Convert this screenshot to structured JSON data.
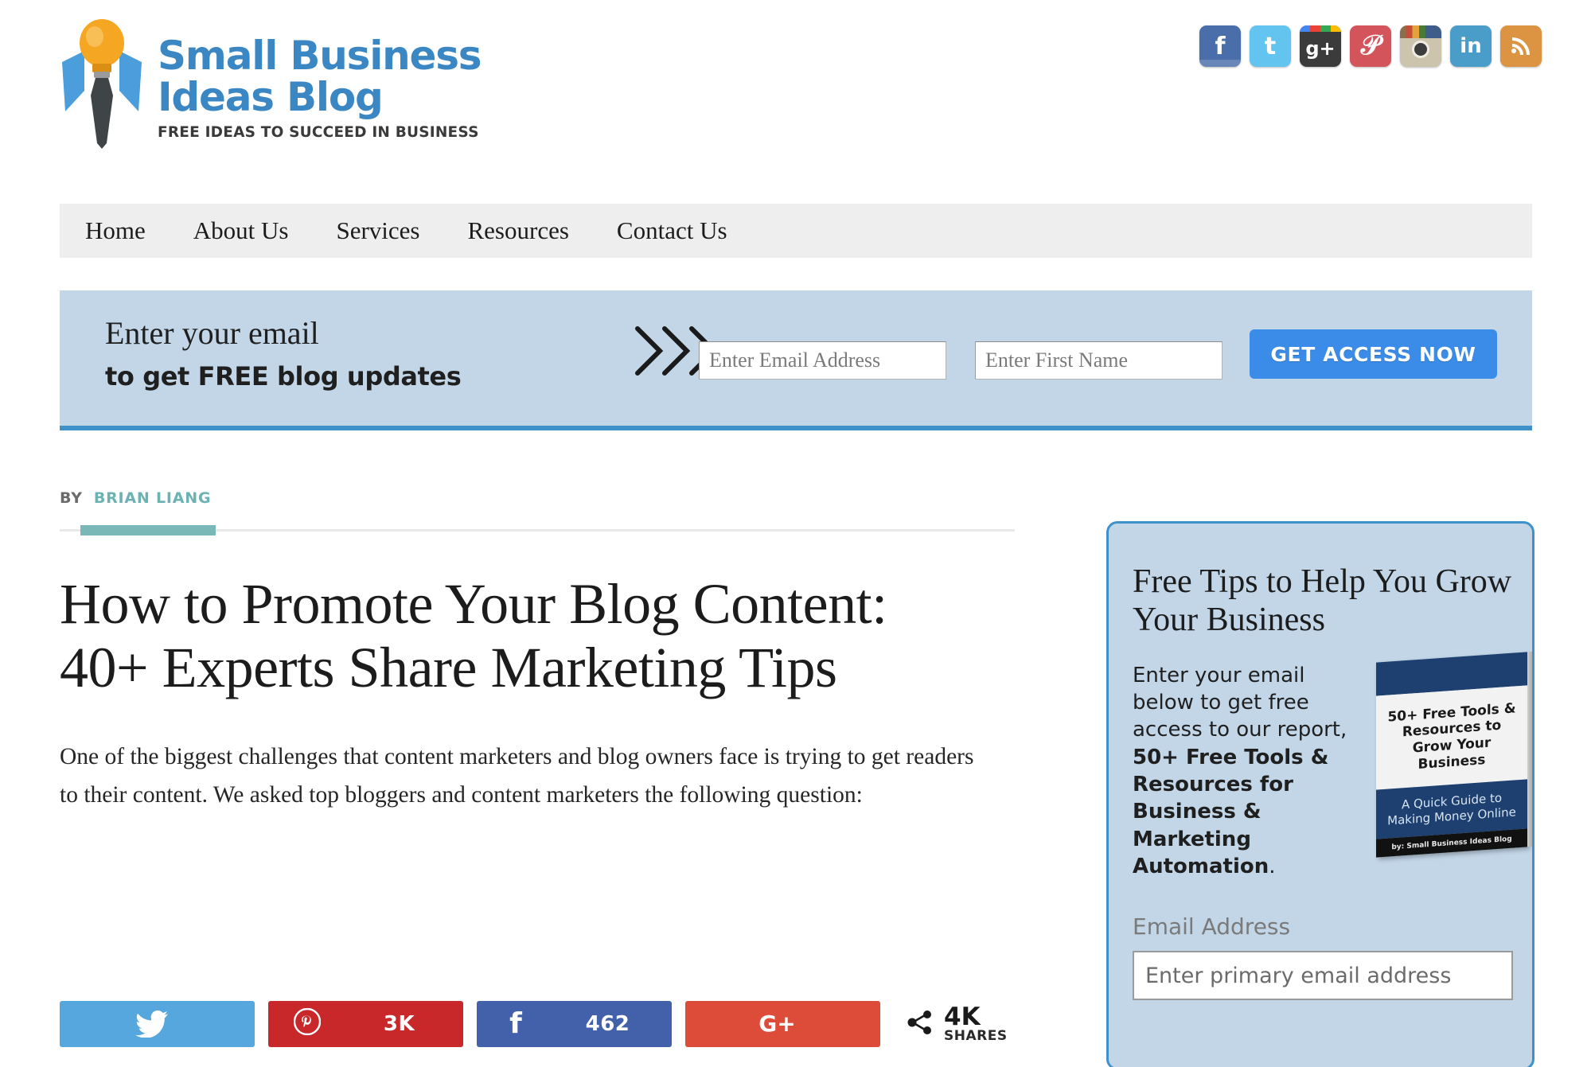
{
  "site": {
    "logo_line1": "Small Business",
    "logo_line2": "Ideas Blog",
    "tagline": "FREE IDEAS TO SUCCEED IN BUSINESS"
  },
  "social": [
    {
      "name": "facebook-icon",
      "glyph": "f",
      "color": "#4a6ea9"
    },
    {
      "name": "twitter-icon",
      "glyph": "t",
      "color": "#62c4ef"
    },
    {
      "name": "google-plus-icon",
      "glyph": "g+",
      "color": "#3b3b3b"
    },
    {
      "name": "pinterest-icon",
      "glyph": "р",
      "color": "#d4545c"
    },
    {
      "name": "instagram-icon",
      "glyph": "",
      "color": "#cdc4ad"
    },
    {
      "name": "linkedin-icon",
      "glyph": "in",
      "color": "#4b9dc9"
    },
    {
      "name": "rss-icon",
      "glyph": "ᴰ",
      "color": "#dd9442"
    }
  ],
  "nav": {
    "items": [
      {
        "label": "Home"
      },
      {
        "label": "About Us"
      },
      {
        "label": "Services"
      },
      {
        "label": "Resources"
      },
      {
        "label": "Contact Us"
      }
    ]
  },
  "optin": {
    "line1": "Enter your email",
    "line2": "to get FREE blog updates",
    "chevrons": "›››",
    "email_placeholder": "Enter Email Address",
    "email_value": "",
    "name_placeholder": "Enter First Name",
    "name_value": "",
    "cta_label": "GET ACCESS NOW",
    "cta_color": "#3b8ce8",
    "background_color": "#c2d6e8",
    "accent_color": "#3e92c9"
  },
  "article": {
    "by_label": "BY",
    "author": "BRIAN LIANG",
    "author_color": "#6db2b2",
    "title": "How to Promote Your Blog Content: 40+ Experts Share Marketing Tips",
    "paragraph": "One of the biggest challenges that content marketers and blog owners face is trying to get readers to their content. We asked top bloggers and content marketers the following question:"
  },
  "share": {
    "buttons": [
      {
        "network": "twitter",
        "icon": "🐦",
        "count": "",
        "color": "#55a7dd"
      },
      {
        "network": "pinterest",
        "icon": "Ⓟ",
        "count": "3K",
        "color": "#c8282a"
      },
      {
        "network": "facebook",
        "icon": "f",
        "count": "462",
        "color": "#4360ab"
      },
      {
        "network": "googleplus",
        "icon": "G+",
        "count": "",
        "color": "#dd4b39"
      }
    ],
    "total_count": "4K",
    "total_label": "SHARES",
    "share_icon": "⤳"
  },
  "sidebar": {
    "heading": "Free Tips to Help You Grow Your Business",
    "body_pre": "Enter your email below to get free access to our report, ",
    "body_bold": "50+ Free Tools & Resources for Business & Marketing Automation",
    "body_post": ".",
    "email_label": "Email Address",
    "email_placeholder": "Enter primary email address",
    "email_value": "",
    "border_color": "#3e92c9",
    "background_color": "#c2d6e8",
    "ebook": {
      "title": "50+ Free Tools & Resources to Grow Your Business",
      "subtitle": "A Quick Guide to Making Money Online",
      "footer": "by: Small Business Ideas Blog"
    }
  }
}
